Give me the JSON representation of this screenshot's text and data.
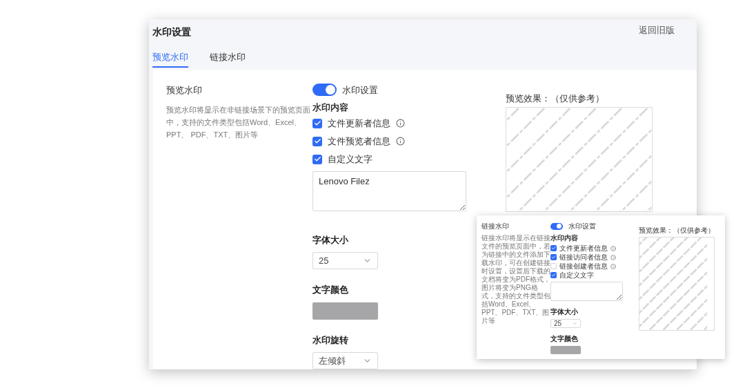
{
  "header": {
    "title": "水印设置",
    "back_link": "返回旧版"
  },
  "tabs": [
    {
      "label": "预览水印",
      "selected": true
    },
    {
      "label": "链接水印",
      "selected": false
    }
  ],
  "preview_watermark": {
    "title": "预览水印",
    "description": "预览水印将显示在非链接场景下的预览页面中，支持的文件类型包括Word、Excel、PPT、 PDF、TXT、图片等",
    "toggle": {
      "label": "水印设置",
      "on": true
    },
    "content_heading": "水印内容",
    "options": [
      {
        "label": "文件更新者信息",
        "checked": true,
        "info": true
      },
      {
        "label": "文件预览者信息",
        "checked": true,
        "info": true
      },
      {
        "label": "自定义文字",
        "checked": true,
        "info": false
      }
    ],
    "custom_text": "Lenovo Filez",
    "font_size": {
      "label": "字体大小",
      "value": "25"
    },
    "text_color": {
      "label": "文字颜色",
      "color": "#a6a6a8"
    },
    "rotation": {
      "label": "水印旋转",
      "value": "左倾斜"
    },
    "preview_label": "预览效果：（仅供参考）"
  },
  "link_watermark": {
    "title": "链接水印",
    "description": "链接水印将显示在链接文件的预览页面中，若为链接中的文件添加下载水印，可在创建链接时设置，设置后下载的文档将变为PDF格式，图片将变为PNG格式，支持的文件类型包括Word、Excel、PPT、PDF、TXT、图片等",
    "toggle": {
      "label": "水印设置",
      "on": true
    },
    "content_heading": "水印内容",
    "options": [
      {
        "label": "文件更新者信息",
        "checked": true,
        "info": true
      },
      {
        "label": "链接访问者信息",
        "checked": true,
        "info": true
      },
      {
        "label": "链接创建者信息",
        "checked": false,
        "info": true
      },
      {
        "label": "自定义文字",
        "checked": true,
        "info": false
      }
    ],
    "font_size": {
      "label": "字体大小",
      "value": "25"
    },
    "text_color": {
      "label": "文字颜色",
      "color": "#a6a6a8"
    },
    "preview_label": "预览效果：（仅供参考）"
  }
}
